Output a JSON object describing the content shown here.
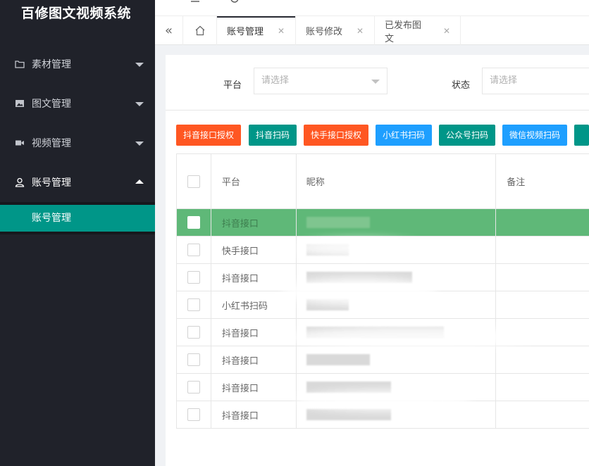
{
  "app": {
    "title": "百修图文视频系统"
  },
  "sidebar": {
    "items": [
      {
        "label": "素材管理",
        "icon": "folder-icon",
        "expanded": false
      },
      {
        "label": "图文管理",
        "icon": "image-icon",
        "expanded": false
      },
      {
        "label": "视频管理",
        "icon": "video-camera-icon",
        "expanded": false
      },
      {
        "label": "账号管理",
        "icon": "user-icon",
        "expanded": true
      }
    ],
    "submenu": [
      {
        "label": "账号管理",
        "active": true
      }
    ]
  },
  "tabs": [
    {
      "label": "账号管理",
      "active": true
    },
    {
      "label": "账号修改",
      "active": false
    },
    {
      "label": "已发布图文",
      "active": false
    }
  ],
  "filters": {
    "platform": {
      "label": "平台",
      "placeholder": "请选择"
    },
    "status": {
      "label": "状态",
      "placeholder": "请选择"
    }
  },
  "toolbar": {
    "buttons": [
      {
        "label": "抖音接口授权",
        "color": "#ff5722"
      },
      {
        "label": "抖音扫码",
        "color": "#009688"
      },
      {
        "label": "快手接口授权",
        "color": "#ff5722"
      },
      {
        "label": "小红书扫码",
        "color": "#1e9fff"
      },
      {
        "label": "公众号扫码",
        "color": "#009688"
      },
      {
        "label": "微信视频扫码",
        "color": "#1e9fff"
      }
    ]
  },
  "table": {
    "columns": [
      "平台",
      "昵称",
      "备注"
    ],
    "rows": [
      {
        "platform": "抖音接口",
        "selected": true
      },
      {
        "platform": "快手接口",
        "selected": false
      },
      {
        "platform": "抖音接口",
        "selected": false
      },
      {
        "platform": "小红书扫码",
        "selected": false
      },
      {
        "platform": "抖音接口",
        "selected": false
      },
      {
        "platform": "抖音接口",
        "selected": false
      },
      {
        "platform": "抖音接口",
        "selected": false
      },
      {
        "platform": "抖音接口",
        "selected": false
      }
    ]
  },
  "colors": {
    "sidebar_bg": "#20222a",
    "accent": "#009688",
    "selected_row": "#5fb878"
  }
}
